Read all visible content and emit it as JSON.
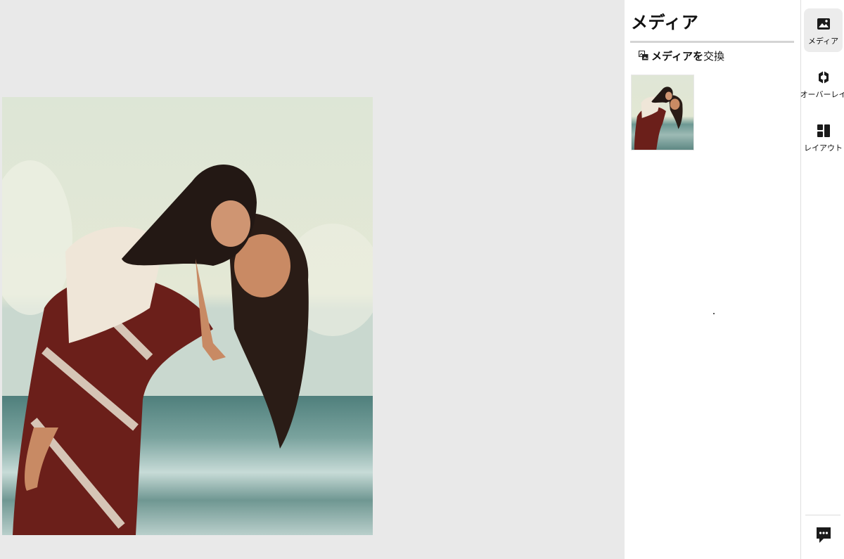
{
  "canvas": {
    "photo_alt": "image-preview"
  },
  "panel": {
    "title": "メディア",
    "replace_button": {
      "label_bold": "メディアを",
      "label_rest": "交換",
      "icon": "swap-media-icon"
    },
    "thumbnails": [
      {
        "icon": "photo-thumbnail"
      }
    ]
  },
  "rail": {
    "items": [
      {
        "label": "メディア",
        "icon": "image-icon",
        "active": true
      },
      {
        "label": "オーバーレイ",
        "icon": "overlay-icon",
        "active": false
      },
      {
        "label": "レイアウト",
        "icon": "layout-icon",
        "active": false
      }
    ],
    "chat_icon": "chat-icon"
  },
  "colors": {
    "canvas_bg": "#e9e9e9",
    "panel_bg": "#ffffff",
    "active_rail_bg": "#ececec",
    "divider": "#d4d4d4"
  }
}
